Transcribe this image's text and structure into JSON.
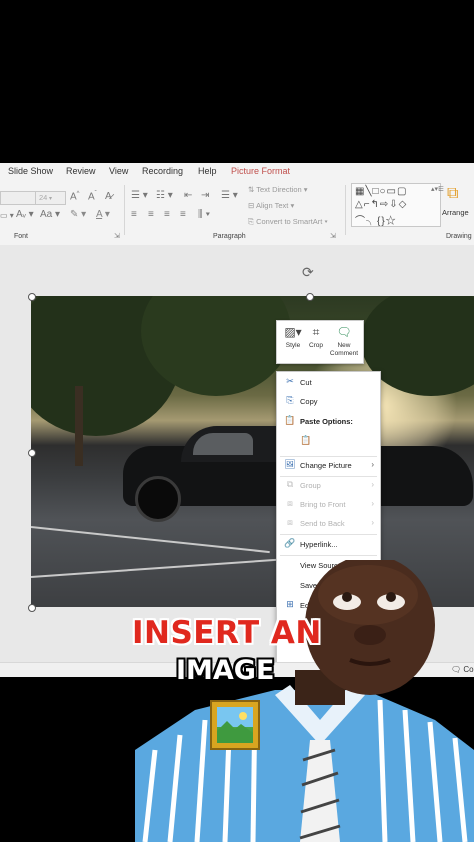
{
  "ribbon": {
    "tabs": [
      {
        "label": "Slide Show"
      },
      {
        "label": "Review"
      },
      {
        "label": "View"
      },
      {
        "label": "Recording"
      },
      {
        "label": "Help"
      },
      {
        "label": "Picture Format",
        "active": true
      }
    ],
    "font_size": "24",
    "paragraph": {
      "text_direction": "Text Direction",
      "align_text": "Align Text",
      "convert_smartart": "Convert to SmartArt"
    },
    "arrange_label": "Arrange",
    "group_labels": {
      "font": "Font",
      "paragraph": "Paragraph",
      "drawing": "Drawing"
    }
  },
  "mini_toolbar": {
    "style": "Style",
    "crop": "Crop",
    "new_comment": "New Comment"
  },
  "context_menu": {
    "items": [
      {
        "label": "Cut",
        "icon": "scissors-icon",
        "enabled": true
      },
      {
        "label": "Copy",
        "icon": "copy-icon",
        "enabled": true
      },
      {
        "label": "Paste Options:",
        "icon": "paste-icon",
        "enabled": true,
        "bold": true
      },
      {
        "label": "Change Picture",
        "icon": "change-picture-icon",
        "enabled": true,
        "submenu": true
      },
      {
        "label": "Group",
        "icon": "group-icon",
        "enabled": false,
        "submenu": true
      },
      {
        "label": "Bring to Front",
        "icon": "bring-front-icon",
        "enabled": false,
        "submenu": true
      },
      {
        "label": "Send to Back",
        "icon": "send-back-icon",
        "enabled": false,
        "submenu": true
      },
      {
        "label": "Hyperlink...",
        "icon": "link-icon",
        "enabled": true
      },
      {
        "label": "View Source",
        "icon": "",
        "enabled": true
      },
      {
        "label": "Save",
        "icon": "",
        "enabled": true
      },
      {
        "label": "Ed",
        "icon": "edit-icon",
        "enabled": true
      },
      {
        "label": "Ne",
        "icon": "",
        "enabled": true
      }
    ]
  },
  "status": {
    "comments": "Co"
  },
  "overlay": {
    "line1": "INSERT AN",
    "line2": "IMAGE"
  },
  "colors": {
    "accent": "#c0504d",
    "caption_red": "#e0281e"
  }
}
